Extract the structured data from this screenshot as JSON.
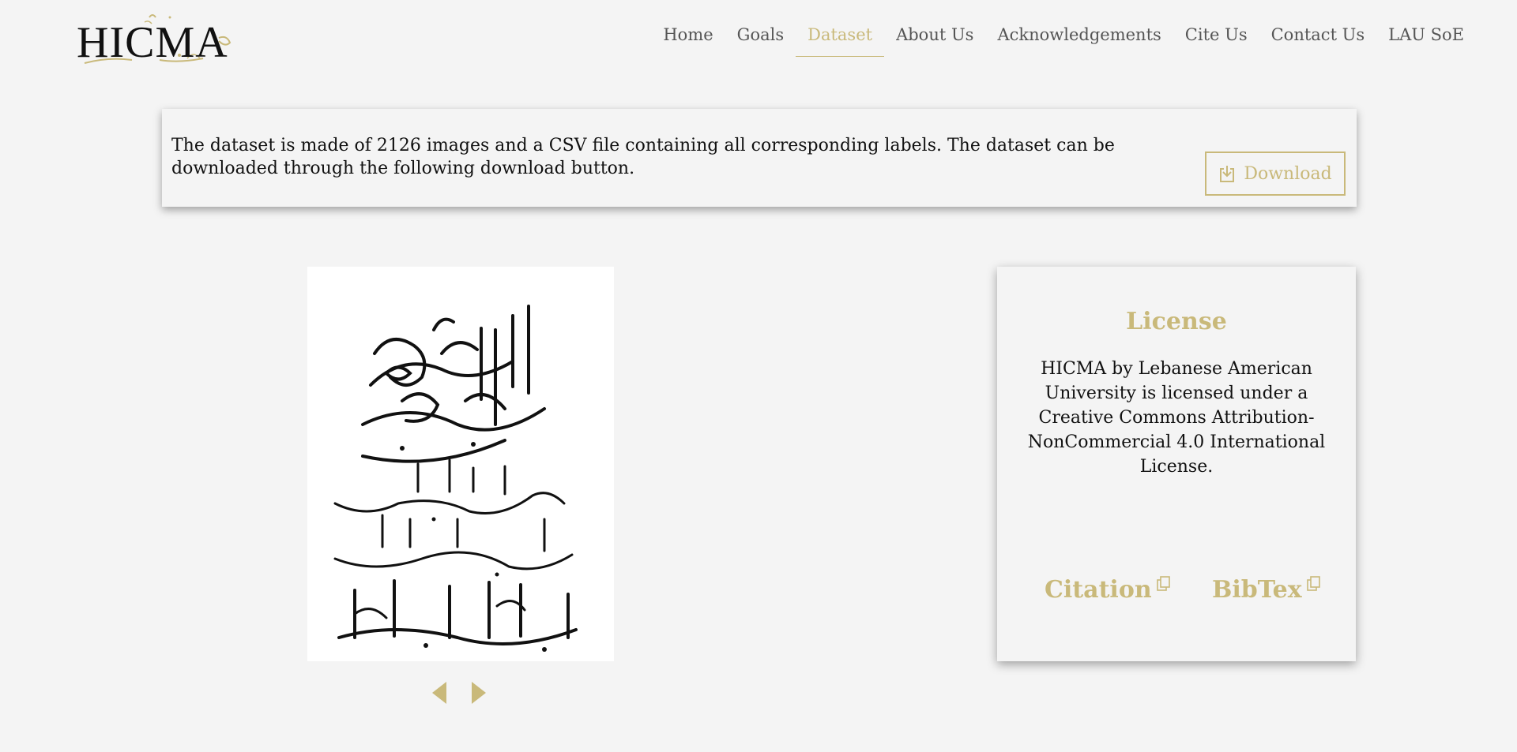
{
  "brand": {
    "logo_text": "HICMA"
  },
  "nav": {
    "items": [
      "Home",
      "Goals",
      "Dataset",
      "About Us",
      "Acknowledgements",
      "Cite Us",
      "Contact Us",
      "LAU SoE"
    ],
    "active": "Dataset"
  },
  "info": {
    "text": "The dataset is made of 2126 images and a CSV file containing all corresponding labels. The dataset can be downloaded through the following download button.",
    "download_label": "Download",
    "download_icon": "download-icon"
  },
  "carousel": {
    "prev_icon": "caret-left-icon",
    "next_icon": "caret-right-icon"
  },
  "license": {
    "title": "License",
    "text": "HICMA by Lebanese American University is licensed under a Creative Commons Attribution-NonCommercial 4.0 International License.",
    "citation_label": "Citation",
    "bibtex_label": "BibTex",
    "copy_icon": "copy-icon"
  },
  "colors": {
    "accent": "#c9b97a",
    "background": "#f4f4f4",
    "text": "#111111",
    "nav_text": "#555555"
  }
}
